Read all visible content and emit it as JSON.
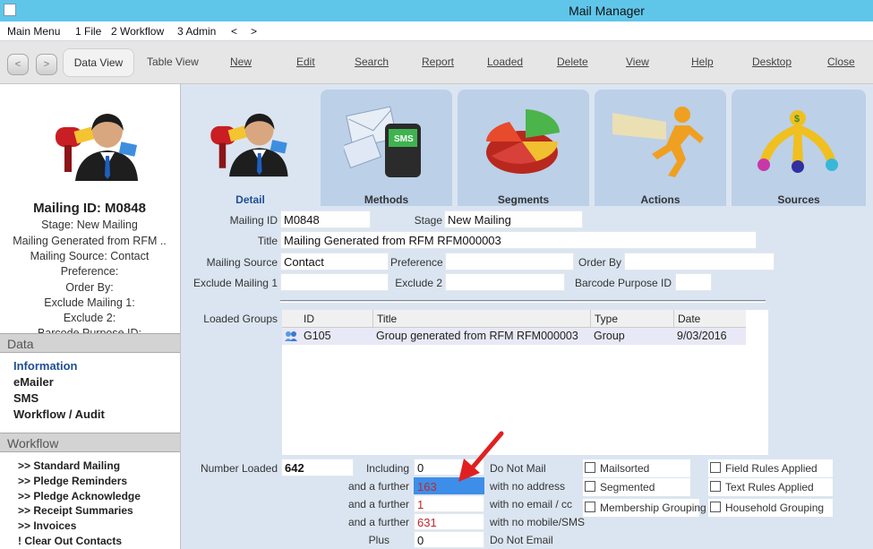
{
  "window": {
    "title": "Mail Manager"
  },
  "menu": [
    "Main Menu",
    "1 File",
    "2 Workflow",
    "3 Admin",
    "<",
    ">"
  ],
  "toolbar": {
    "back": "<",
    "forward": ">",
    "items": [
      "Data View",
      "Table View",
      "New",
      "Edit",
      "Search",
      "Report",
      "Loaded",
      "Delete",
      "View",
      "Help",
      "Desktop",
      "Close"
    ]
  },
  "summary": {
    "heading": "Mailing ID: M0848",
    "lines": [
      "Stage: New Mailing",
      "Mailing Generated from RFM ..",
      "Mailing Source: Contact",
      "Preference:",
      "Order By:",
      "Exclude Mailing 1:",
      "Exclude 2:",
      "Barcode Purpose ID:"
    ]
  },
  "sidebar": {
    "data_header": "Data",
    "data_links": [
      "Information",
      "eMailer",
      "SMS",
      "Workflow / Audit"
    ],
    "workflow_header": "Workflow",
    "workflow_links": [
      ">> Standard Mailing",
      ">> Pledge Reminders",
      ">> Pledge Acknowledge",
      ">> Receipt Summaries",
      ">> Invoices",
      "! Clear Out Contacts"
    ]
  },
  "tabs": [
    "Detail",
    "Methods",
    "Segments",
    "Actions",
    "Sources"
  ],
  "form": {
    "mailing_id_label": "Mailing ID",
    "mailing_id": "M0848",
    "stage_label": "Stage",
    "stage": "New Mailing",
    "title_label": "Title",
    "title": "Mailing Generated from RFM RFM000003",
    "source_label": "Mailing Source",
    "source": "Contact",
    "preference_label": "Preference",
    "preference": "",
    "order_by_label": "Order By",
    "order_by": "",
    "exclude1_label": "Exclude Mailing 1",
    "exclude1": "",
    "exclude2_label": "Exclude 2",
    "exclude2": "",
    "barcode_label": "Barcode Purpose ID",
    "barcode": ""
  },
  "groups": {
    "label": "Loaded Groups",
    "columns": [
      "ID",
      "Title",
      "Type",
      "Date"
    ],
    "rows": [
      {
        "id": "G105",
        "title": "Group generated from RFM RFM000003",
        "type": "Group",
        "date": "9/03/2016"
      }
    ]
  },
  "counts": {
    "number_loaded_label": "Number Loaded",
    "number_loaded": "642",
    "including_label": "Including",
    "including": "0",
    "including_desc": "Do Not Mail",
    "further_label": "and a further",
    "no_address": "163",
    "no_address_desc": "with no address",
    "no_email": "1",
    "no_email_desc": "with no email / cc",
    "no_mobile": "631",
    "no_mobile_desc": "with no mobile/SMS",
    "plus_label": "Plus",
    "plus": "0",
    "plus_desc": "Do Not Email"
  },
  "checkboxes": [
    "Mailsorted",
    "Segmented",
    "Membership Grouping",
    "Field Rules Applied",
    "Text Rules Applied",
    "Household Grouping"
  ],
  "colors": {
    "highlight": "#3d8ee8",
    "arrow": "#e02020",
    "red_text": "#c0282c",
    "tab_selected_text": "#1f4e96"
  }
}
